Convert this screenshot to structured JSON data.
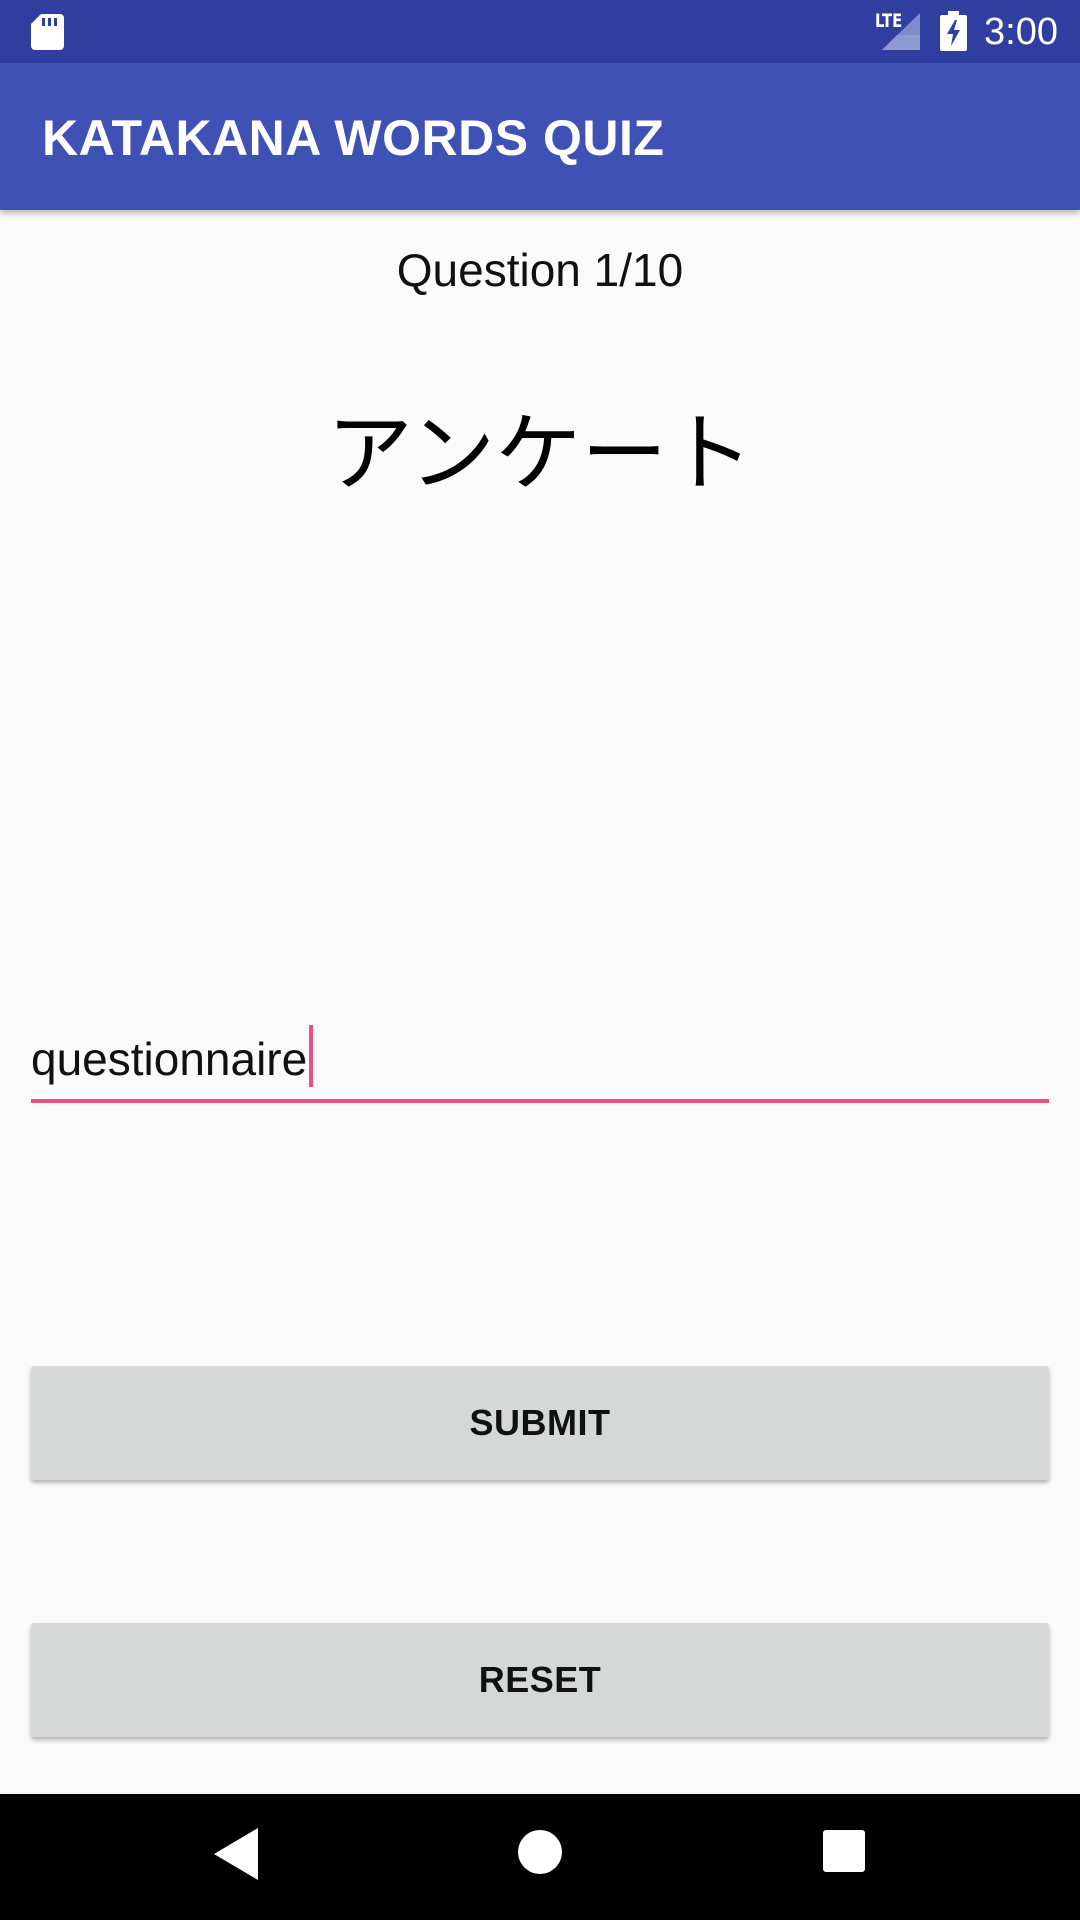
{
  "status_bar": {
    "network": "LTE",
    "time": "3:00",
    "icons": [
      "sd-card-icon",
      "signal-icon",
      "battery-charging-icon"
    ]
  },
  "app_bar": {
    "title": "KATAKANA WORDS QUIZ"
  },
  "quiz": {
    "counter": "Question 1/10",
    "word": "アンケート",
    "answer_value": "questionnaire"
  },
  "buttons": {
    "submit": "SUBMIT",
    "reset": "RESET"
  },
  "nav_bar": {
    "icons": [
      "back-icon",
      "home-icon",
      "recents-icon"
    ]
  },
  "colors": {
    "status_bar": "#303f9f",
    "app_bar": "#3f51b5",
    "accent": "#e94f87",
    "button": "#d6d7d7",
    "background": "#fafafa"
  }
}
